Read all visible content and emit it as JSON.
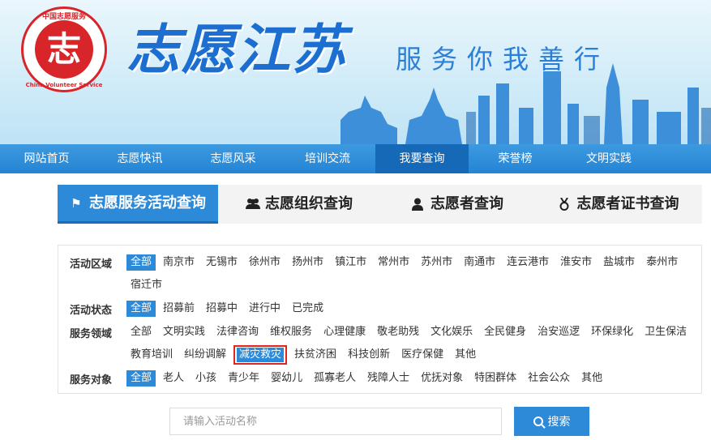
{
  "header": {
    "logo_top": "中国志愿服务",
    "logo_char": "志",
    "logo_bottom": "China Volunteer Service",
    "site_title": "志愿江苏",
    "slogan": "服务你我善行"
  },
  "nav": {
    "items": [
      {
        "label": "网站首页",
        "active": false
      },
      {
        "label": "志愿快讯",
        "active": false
      },
      {
        "label": "志愿风采",
        "active": false
      },
      {
        "label": "培训交流",
        "active": false
      },
      {
        "label": "我要查询",
        "active": true
      },
      {
        "label": "荣誉榜",
        "active": false
      },
      {
        "label": "文明实践",
        "active": false
      }
    ]
  },
  "query_tabs": [
    {
      "label": "志愿服务活动查询",
      "icon": "flag-icon",
      "active": true
    },
    {
      "label": "志愿组织查询",
      "icon": "group-icon",
      "active": false
    },
    {
      "label": "志愿者查询",
      "icon": "person-icon",
      "active": false
    },
    {
      "label": "志愿者证书查询",
      "icon": "medal-icon",
      "active": false
    }
  ],
  "filters": {
    "area": {
      "label": "活动区域",
      "options": [
        "全部",
        "南京市",
        "无锡市",
        "徐州市",
        "扬州市",
        "镇江市",
        "常州市",
        "苏州市",
        "南通市",
        "连云港市",
        "淮安市",
        "盐城市",
        "泰州市",
        "宿迁市"
      ],
      "selected": "全部"
    },
    "status": {
      "label": "活动状态",
      "options": [
        "全部",
        "招募前",
        "招募中",
        "进行中",
        "已完成"
      ],
      "selected": "全部"
    },
    "field": {
      "label": "服务领域",
      "options": [
        "全部",
        "文明实践",
        "法律咨询",
        "维权服务",
        "心理健康",
        "敬老助残",
        "文化娱乐",
        "全民健身",
        "治安巡逻",
        "环保绿化",
        "卫生保洁",
        "教育培训",
        "纠纷调解",
        "减灾救灾",
        "扶贫济困",
        "科技创新",
        "医疗保健",
        "其他"
      ],
      "selected": "减灾救灾"
    },
    "target": {
      "label": "服务对象",
      "options": [
        "全部",
        "老人",
        "小孩",
        "青少年",
        "婴幼儿",
        "孤寡老人",
        "残障人士",
        "优抚对象",
        "特困群体",
        "社会公众",
        "其他"
      ],
      "selected": "全部"
    }
  },
  "search": {
    "placeholder": "请输入活动名称",
    "button_label": "搜索"
  },
  "colors": {
    "nav_bg": "#2584d3",
    "accent": "#2c8ad8",
    "highlight_border": "#e0251f",
    "logo_red": "#d8252a"
  }
}
